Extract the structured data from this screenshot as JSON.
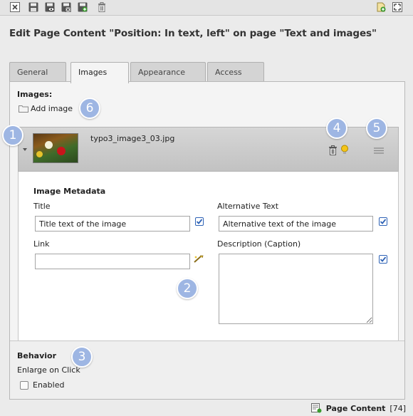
{
  "toolbar": {
    "icons": [
      "close-icon",
      "save-icon",
      "save-view-icon",
      "save-close-icon",
      "save-new-icon",
      "delete-icon",
      "new-page-icon",
      "fullscreen-icon"
    ]
  },
  "page_title": "Edit Page Content \"Position: In text, left\" on page \"Text and images\"",
  "tabs": [
    {
      "label": "General",
      "active": false
    },
    {
      "label": "Images",
      "active": true
    },
    {
      "label": "Appearance",
      "active": false
    },
    {
      "label": "Access",
      "active": false
    }
  ],
  "images_section": {
    "label": "Images:",
    "add_image": "Add image"
  },
  "image_item": {
    "filename": "typo3_image3_03.jpg",
    "metadata_heading": "Image Metadata",
    "title_label": "Title",
    "title_value": "Title text of the image",
    "alt_label": "Alternative Text",
    "alt_value": "Alternative text of the image",
    "link_label": "Link",
    "link_value": "",
    "description_label": "Description (Caption)",
    "description_value": ""
  },
  "behavior": {
    "heading": "Behavior",
    "enlarge_label": "Enlarge on Click",
    "enabled_label": "Enabled",
    "enabled_checked": false
  },
  "markers": [
    "1",
    "2",
    "3",
    "4",
    "5",
    "6"
  ],
  "footer": {
    "content_type": "Page Content",
    "uid": "[74]"
  },
  "colors": {
    "marker": "#9eb6e3",
    "checkbox_blue": "#2f63b6"
  }
}
